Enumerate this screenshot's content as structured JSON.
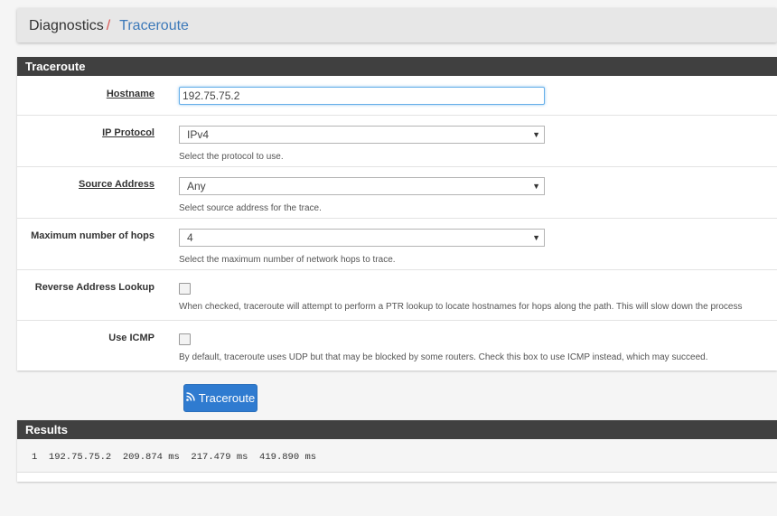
{
  "breadcrumb": {
    "root": "Diagnostics",
    "separator": "/",
    "current": "Traceroute"
  },
  "form": {
    "title": "Traceroute",
    "hostname": {
      "label": "Hostname",
      "value": "192.75.75.2"
    },
    "ip_protocol": {
      "label": "IP Protocol",
      "value": "IPv4",
      "help": "Select the protocol to use."
    },
    "source_address": {
      "label": "Source Address",
      "value": "Any",
      "help": "Select source address for the trace."
    },
    "max_hops": {
      "label": "Maximum number of hops",
      "value": "4",
      "help": "Select the maximum number of network hops to trace."
    },
    "reverse_lookup": {
      "label": "Reverse Address Lookup",
      "checked": false,
      "help": "When checked, traceroute will attempt to perform a PTR lookup to locate hostnames for hops along the path. This will slow down the process"
    },
    "use_icmp": {
      "label": "Use ICMP",
      "checked": false,
      "help": "By default, traceroute uses UDP but that may be blocked by some routers. Check this box to use ICMP instead, which may succeed."
    },
    "submit_label": "Traceroute"
  },
  "results": {
    "title": "Results",
    "output": "1  192.75.75.2  209.874 ms  217.479 ms  419.890 ms"
  },
  "icons": {
    "submit": "rss-icon",
    "select": "caret-down-icon"
  },
  "colors": {
    "accent": "#2f7bd0",
    "breadcrumb_sep": "#d9534f",
    "breadcrumb_link": "#3c79b9",
    "panel_header": "#404040"
  }
}
